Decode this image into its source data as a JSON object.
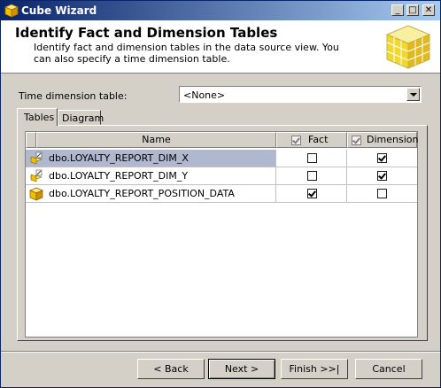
{
  "window": {
    "title": "Cube Wizard"
  },
  "header": {
    "title": "Identify Fact and Dimension Tables",
    "description": "Identify fact and dimension tables in the data source view. You can also specify a time dimension table."
  },
  "time_dimension": {
    "label": "Time dimension table:",
    "value": "<None>"
  },
  "tabs": [
    {
      "label": "Tables"
    },
    {
      "label": "Diagram"
    }
  ],
  "grid": {
    "columns": {
      "name": "Name",
      "fact": "Fact",
      "dimension": "Dimension"
    },
    "rows": [
      {
        "name": "dbo.LOYALTY_REPORT_DIM_X",
        "fact": false,
        "dimension": true,
        "icon": "dimension-table-icon"
      },
      {
        "name": "dbo.LOYALTY_REPORT_DIM_Y",
        "fact": false,
        "dimension": true,
        "icon": "dimension-table-icon"
      },
      {
        "name": "dbo.LOYALTY_REPORT_POSITION_DATA",
        "fact": true,
        "dimension": false,
        "icon": "fact-table-icon"
      }
    ]
  },
  "buttons": {
    "back": "< Back",
    "next": "Next >",
    "finish": "Finish >>|",
    "cancel": "Cancel"
  }
}
